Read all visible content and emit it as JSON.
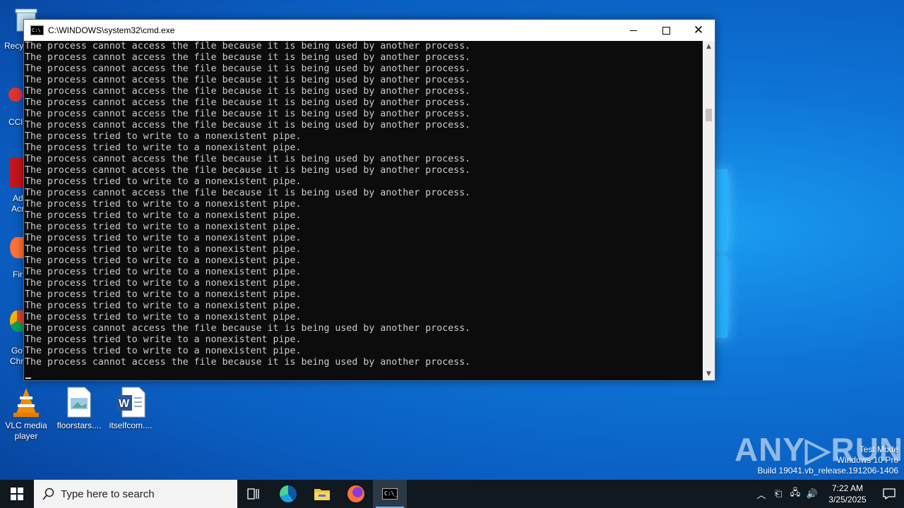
{
  "desktop": {
    "icons": [
      {
        "label": "VLC media player"
      },
      {
        "label": "floorstars...."
      },
      {
        "label": "itselfcom...."
      }
    ],
    "left_stubs": [
      "Recy",
      "CCl",
      "Ad",
      "Acr",
      "Fir",
      "Go",
      "Chr"
    ]
  },
  "cmd_window": {
    "title": "C:\\WINDOWS\\system32\\cmd.exe",
    "app_icon_text": "C:\\_",
    "lines": [
      "The process cannot access the file because it is being used by another process.",
      "The process cannot access the file because it is being used by another process.",
      "The process cannot access the file because it is being used by another process.",
      "The process cannot access the file because it is being used by another process.",
      "The process cannot access the file because it is being used by another process.",
      "The process cannot access the file because it is being used by another process.",
      "The process cannot access the file because it is being used by another process.",
      "The process cannot access the file because it is being used by another process.",
      "The process tried to write to a nonexistent pipe.",
      "The process tried to write to a nonexistent pipe.",
      "The process cannot access the file because it is being used by another process.",
      "The process cannot access the file because it is being used by another process.",
      "The process tried to write to a nonexistent pipe.",
      "The process cannot access the file because it is being used by another process.",
      "The process tried to write to a nonexistent pipe.",
      "The process tried to write to a nonexistent pipe.",
      "The process tried to write to a nonexistent pipe.",
      "The process tried to write to a nonexistent pipe.",
      "The process tried to write to a nonexistent pipe.",
      "The process tried to write to a nonexistent pipe.",
      "The process tried to write to a nonexistent pipe.",
      "The process tried to write to a nonexistent pipe.",
      "The process tried to write to a nonexistent pipe.",
      "The process tried to write to a nonexistent pipe.",
      "The process tried to write to a nonexistent pipe.",
      "The process cannot access the file because it is being used by another process.",
      "The process tried to write to a nonexistent pipe.",
      "The process tried to write to a nonexistent pipe.",
      "The process cannot access the file because it is being used by another process."
    ]
  },
  "watermark": {
    "brand": "ANY.RUN",
    "line1": "Test Mode",
    "line2": "Windows 10 Pro",
    "line3": "Build 19041.vb_release.191206-1406"
  },
  "taskbar": {
    "search_placeholder": "Type here to search",
    "time": "7:22 AM",
    "date": "3/25/2025",
    "apps": [
      "task-view",
      "edge",
      "file-explorer",
      "firefox",
      "cmd"
    ],
    "accent": "#76b9ed"
  },
  "colors": {
    "console_bg": "#0c0c0c",
    "console_fg": "#cccccc",
    "taskbar_bg": "#101820"
  }
}
